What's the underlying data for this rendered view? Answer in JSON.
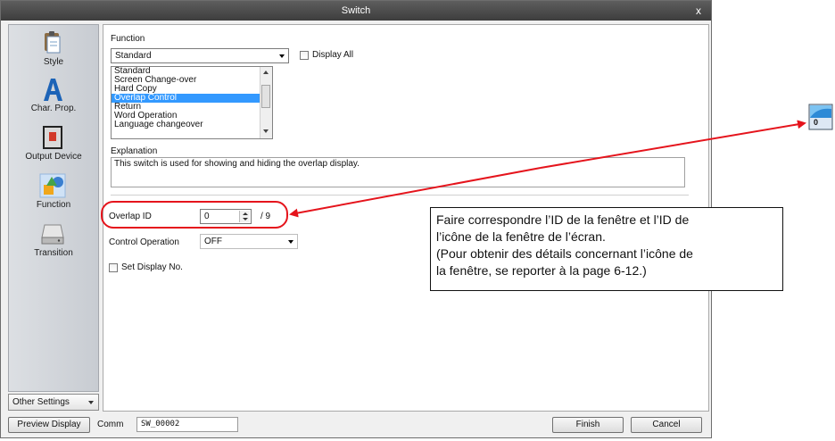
{
  "window": {
    "title": "Switch",
    "close_glyph": "x"
  },
  "sidebar": {
    "items": [
      {
        "label": "Style",
        "icon": "clipboard-icon"
      },
      {
        "label": "Char. Prop.",
        "icon": "letter-a-icon"
      },
      {
        "label": "Output Device",
        "icon": "lamp-device-icon"
      },
      {
        "label": "Function",
        "icon": "shapes-icon"
      },
      {
        "label": "Transition",
        "icon": "drive-icon"
      }
    ],
    "other_settings": "Other Settings"
  },
  "function": {
    "label": "Function",
    "selected": "Standard",
    "display_all_label": "Display All",
    "list": [
      "Standard",
      "Screen Change-over",
      "Hard Copy",
      "Overlap Control",
      "Return",
      "Word Operation",
      "Language changeover"
    ],
    "list_selected": "Overlap Control"
  },
  "explanation": {
    "label": "Explanation",
    "text": "This switch is used for showing and hiding the overlap display."
  },
  "overlap": {
    "label": "Overlap ID",
    "value": "0",
    "max": "/ 9"
  },
  "control_operation": {
    "label": "Control Operation",
    "value": "OFF"
  },
  "set_display_no": {
    "label": "Set Display No."
  },
  "bottom": {
    "preview_label": "Preview Display",
    "comm_label": "Comm",
    "comm_value": "SW_00002",
    "finish_label": "Finish",
    "cancel_label": "Cancel"
  },
  "annotation": {
    "line1": "Faire correspondre l’ID de la fenêtre et l’ID de",
    "line2": "l’icône de la fenêtre de l’écran.",
    "line3": "(Pour obtenir des détails concernant l’icône de",
    "line4": "la fenêtre, se reporter à la page 6-12.)"
  },
  "window_icon": {
    "digit": "0"
  },
  "colors": {
    "highlight": "#e5141c",
    "selection": "#3399ff"
  }
}
